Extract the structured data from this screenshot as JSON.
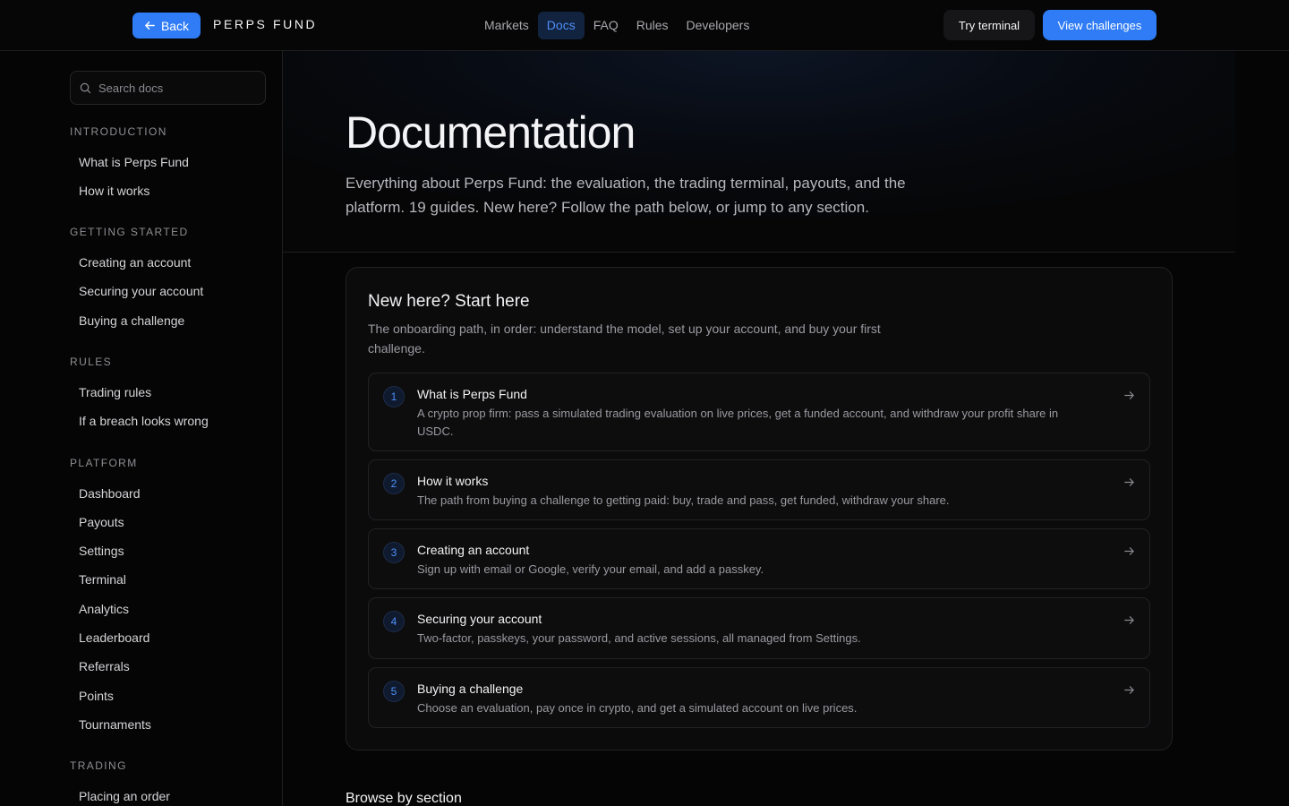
{
  "topbar": {
    "back_label": "Back",
    "brand": "PERPS FUND",
    "nav": [
      "Markets",
      "Docs",
      "FAQ",
      "Rules",
      "Developers"
    ],
    "active_nav": "Docs",
    "try_label": "Try terminal",
    "view_label": "View challenges"
  },
  "sidebar": {
    "search_placeholder": "Search docs",
    "sections": [
      {
        "title": "INTRODUCTION",
        "items": [
          "What is Perps Fund",
          "How it works"
        ]
      },
      {
        "title": "GETTING STARTED",
        "items": [
          "Creating an account",
          "Securing your account",
          "Buying a challenge"
        ]
      },
      {
        "title": "RULES",
        "items": [
          "Trading rules",
          "If a breach looks wrong"
        ]
      },
      {
        "title": "PLATFORM",
        "items": [
          "Dashboard",
          "Payouts",
          "Settings",
          "Terminal",
          "Analytics",
          "Leaderboard",
          "Referrals",
          "Points",
          "Tournaments"
        ]
      },
      {
        "title": "TRADING",
        "items": [
          "Placing an order"
        ]
      }
    ]
  },
  "hero": {
    "title": "Documentation",
    "lead": "Everything about Perps Fund: the evaluation, the trading terminal, payouts, and the platform. 19 guides. New here? Follow the path below, or jump to any section."
  },
  "start": {
    "title": "New here? Start here",
    "subtitle": "The onboarding path, in order: understand the model, set up your account, and buy your first challenge.",
    "steps": [
      {
        "num": "1",
        "title": "What is Perps Fund",
        "desc": "A crypto prop firm: pass a simulated trading evaluation on live prices, get a funded account, and withdraw your profit share in USDC."
      },
      {
        "num": "2",
        "title": "How it works",
        "desc": "The path from buying a challenge to getting paid: buy, trade and pass, get funded, withdraw your share."
      },
      {
        "num": "3",
        "title": "Creating an account",
        "desc": "Sign up with email or Google, verify your email, and add a passkey."
      },
      {
        "num": "4",
        "title": "Securing your account",
        "desc": "Two-factor, passkeys, your password, and active sessions, all managed from Settings."
      },
      {
        "num": "5",
        "title": "Buying a challenge",
        "desc": "Choose an evaluation, pay once in crypto, and get a simulated account on live prices."
      }
    ]
  },
  "browse": {
    "title": "Browse by section"
  },
  "colors": {
    "accent": "#2f7cf6",
    "background": "#050505",
    "card": "#0b0b0c"
  }
}
